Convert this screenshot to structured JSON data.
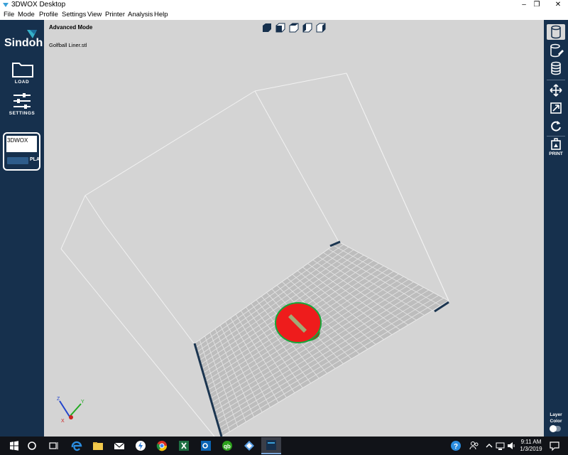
{
  "window": {
    "title": "3DWOX Desktop",
    "minimize": "–",
    "maximize": "❐",
    "close": "✕"
  },
  "menu": [
    "File",
    "Mode",
    "Profile",
    "Settings",
    "View",
    "Printer",
    "Analysis",
    "Help"
  ],
  "left_sidebar": {
    "brand": "Sindoh",
    "load_label": "LOAD",
    "settings_label": "SETTINGS",
    "profile": {
      "printer": "3DWOX",
      "material": "PLA"
    }
  },
  "viewport": {
    "mode": "Advanced Mode",
    "file": "Golfball Liner.stl",
    "model_color": "#ee1c1c",
    "axes": {
      "x": "X",
      "y": "Y",
      "z": "Z"
    }
  },
  "right_sidebar": {
    "print_label": "PRINT",
    "layer_color_label": "Layer\nColor"
  },
  "taskbar": {
    "time": "9:11 AM",
    "date": "1/3/2019"
  }
}
